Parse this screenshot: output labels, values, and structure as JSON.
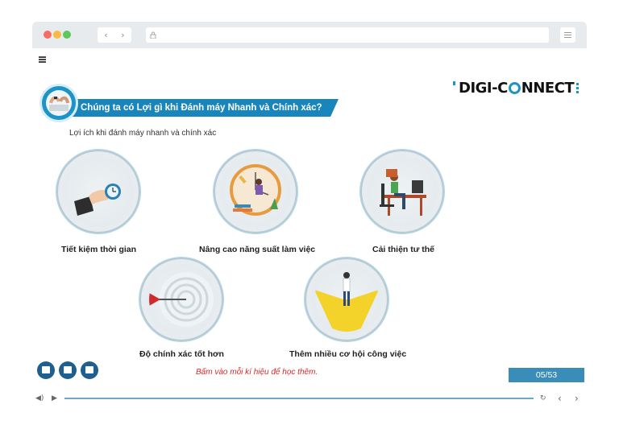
{
  "browser": {
    "back_glyph": "‹",
    "forward_glyph": "›",
    "lock_icon": "lock-icon",
    "menu_icon": "menu-icon"
  },
  "slide": {
    "title": "Chúng ta có Lợi gì khi Đánh máy Nhanh và Chính xác?",
    "subtitle": "Lợi ích khi đánh máy nhanh và chính xác",
    "logo_left": "DIGI-C",
    "logo_right": "NNECT",
    "items": [
      {
        "label": "Tiết kiệm thời gian",
        "icon": "hand-watch-icon"
      },
      {
        "label": "Nâng cao năng suất làm việc",
        "icon": "clock-productivity-icon"
      },
      {
        "label": "Cải thiện tư thế",
        "icon": "desk-posture-icon"
      },
      {
        "label": "Độ chính xác tốt hơn",
        "icon": "dart-target-icon"
      },
      {
        "label": "Thêm nhiều cơ hội công việc",
        "icon": "crossroads-person-icon"
      }
    ],
    "hint": "Bấm vào mỗi kí hiệu để học thêm.",
    "page_counter": "05/53"
  },
  "player": {
    "volume_glyph": "◀)",
    "play_glyph": "▶",
    "replay_glyph": "↻",
    "prev_glyph": "‹",
    "next_glyph": "›",
    "progress": 1.0
  },
  "colors": {
    "accent": "#1e93c8",
    "banner": "#1985bd",
    "hint": "#d52b2b",
    "counter_bg": "#3a8db9"
  }
}
